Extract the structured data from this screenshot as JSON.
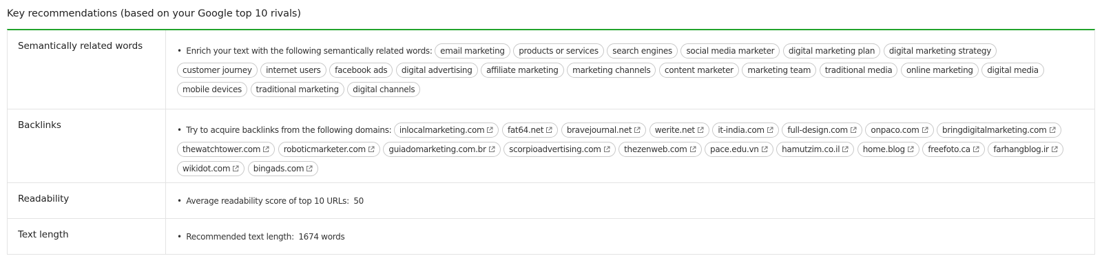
{
  "header": {
    "title": "Key recommendations (based on your Google top 10 rivals)"
  },
  "rows": {
    "semantic": {
      "label": "Semantically related words",
      "bullet": "•",
      "intro": "Enrich your text with the following semantically related words:",
      "tags": [
        "email marketing",
        "products or services",
        "search engines",
        "social media marketer",
        "digital marketing plan",
        "digital marketing strategy",
        "customer journey",
        "internet users",
        "facebook ads",
        "digital advertising",
        "affiliate marketing",
        "marketing channels",
        "content marketer",
        "marketing team",
        "traditional media",
        "online marketing",
        "digital media",
        "mobile devices",
        "traditional marketing",
        "digital channels"
      ]
    },
    "backlinks": {
      "label": "Backlinks",
      "bullet": "•",
      "intro": "Try to acquire backlinks from the following domains:",
      "icon": "external-link-icon",
      "domains": [
        "inlocalmarketing.com",
        "fat64.net",
        "bravejournal.net",
        "werite.net",
        "it-india.com",
        "full-design.com",
        "onpaco.com",
        "bringdigitalmarketing.com",
        "thewatchtower.com",
        "roboticmarketer.com",
        "guiadomarketing.com.br",
        "scorpioadvertising.com",
        "thezenweb.com",
        "pace.edu.vn",
        "hamutzim.co.il",
        "home.blog",
        "freefoto.ca",
        "farhangblog.ir",
        "wikidot.com",
        "bingads.com"
      ]
    },
    "readability": {
      "label": "Readability",
      "bullet": "•",
      "text": "Average readability score of top 10 URLs:",
      "value": "50"
    },
    "textlength": {
      "label": "Text length",
      "bullet": "•",
      "text": "Recommended text length:",
      "value": "1674 words"
    }
  },
  "colors": {
    "accent": "#21a32b",
    "border": "#e3e3e3",
    "tag_border": "#c8c8c8"
  }
}
